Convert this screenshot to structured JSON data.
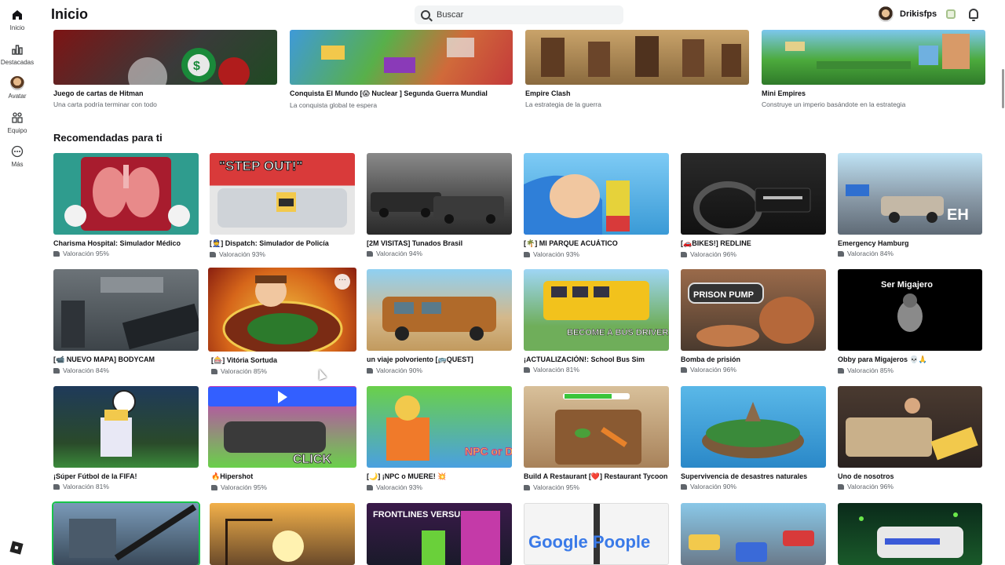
{
  "nav": {
    "items": [
      {
        "label": "Inicio"
      },
      {
        "label": "Destacadas"
      },
      {
        "label": "Avatar"
      },
      {
        "label": "Equipo"
      },
      {
        "label": "Más"
      }
    ]
  },
  "header": {
    "title": "Inicio",
    "search_placeholder": "Buscar",
    "username": "Drikisfps"
  },
  "top_row": [
    {
      "title": "Juego de cartas de Hitman",
      "subtitle": "Una carta podría terminar con todo"
    },
    {
      "title": "Conquista El Mundo [😱 Nuclear ] Segunda Guerra Mundial",
      "subtitle": "La conquista global te espera"
    },
    {
      "title": "Empire Clash",
      "subtitle": "La estrategia de la guerra"
    },
    {
      "title": "Mini Empires",
      "subtitle": "Construye un imperio basándote en la estrategia"
    }
  ],
  "recommended": {
    "title": "Recomendadas para ti",
    "rows": [
      [
        {
          "title": "Charisma Hospital: Simulador Médico",
          "rating": "Valoración 95%"
        },
        {
          "title": "[👮] Dispatch: Simulador de Policía",
          "rating": "Valoración 93%"
        },
        {
          "title": "[2M VISITAS] Tunados Brasil",
          "rating": "Valoración 94%"
        },
        {
          "title": "[🌴] MI PARQUE ACUÁTICO",
          "rating": "Valoración 93%"
        },
        {
          "title": "[🚗BIKES!] REDLINE",
          "rating": "Valoración 96%"
        },
        {
          "title": "Emergency Hamburg",
          "rating": "Valoración 84%"
        }
      ],
      [
        {
          "title": "[📹 NUEVO MAPA] BODYCAM",
          "rating": "Valoración 84%"
        },
        {
          "title": "[🎰] Vitória Sortuda",
          "rating": "Valoración 85%"
        },
        {
          "title": "un viaje polvoriento [🚌QUEST]",
          "rating": "Valoración 90%"
        },
        {
          "title": "¡ACTUALIZACIÓN!: School Bus Sim",
          "rating": "Valoración 81%"
        },
        {
          "title": "Bomba de prisión",
          "rating": "Valoración 96%"
        },
        {
          "title": "Obby para Migajeros 💀🙏",
          "rating": "Valoración 85%"
        }
      ],
      [
        {
          "title": "¡Súper Fútbol de la FIFA!",
          "rating": "Valoración 81%"
        },
        {
          "title": "🔥Hipershot",
          "rating": "Valoración 95%"
        },
        {
          "title": "[🌙] ¡NPC o MUERE! 💥",
          "rating": "Valoración 93%"
        },
        {
          "title": "Build A Restaurant [❤️] Restaurant Tycoon",
          "rating": "Valoración 95%"
        },
        {
          "title": "Supervivencia de desastres naturales",
          "rating": "Valoración 90%"
        },
        {
          "title": "Uno de nosotros",
          "rating": "Valoración 96%"
        }
      ]
    ]
  },
  "thumb_text": {
    "step_out": "\"STEP OUT!\"",
    "bus_driver": "BECOME A BUS DRIVER",
    "prison_pump": "PRISON PUMP",
    "ser_migajero": "Ser Migajero",
    "eh": "EH",
    "click": "CLICK",
    "google_poople": "Google Poople",
    "frontlines": "FRONTLINES VERSUS",
    "npc_die": "NPC or DIE"
  },
  "colors": {
    "accent": "#335fff",
    "highlight": "#18c44a"
  }
}
